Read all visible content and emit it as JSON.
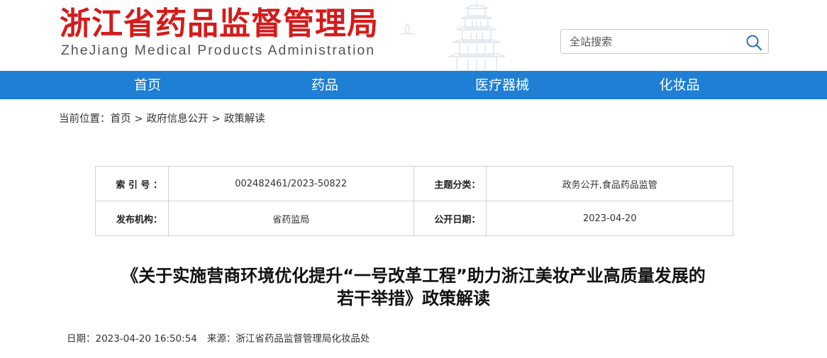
{
  "header": {
    "logo_cn": "浙江省药品监督管理局",
    "logo_en": "ZheJiang Medical Products Administration"
  },
  "search": {
    "placeholder": "全站搜索"
  },
  "nav": {
    "items": [
      "首页",
      "药品",
      "医疗器械",
      "化妆品"
    ]
  },
  "breadcrumb": {
    "prefix": "当前位置：",
    "items": [
      "首页",
      "政府信息公开",
      "政策解读"
    ],
    "separator": ">"
  },
  "meta": {
    "index_label": "索 引 号 ：",
    "index_value": "002482461/2023-50822",
    "category_label": "主题分类：",
    "category_value": "政务公开,食品药品监管",
    "publisher_label": "发布机构：",
    "publisher_value": "省药监局",
    "date_label": "公开日期：",
    "date_value": "2023-04-20"
  },
  "article": {
    "title_line1": "《关于实施营商环境优化提升“一号改革工程”助力浙江美妆产业高质量发展的",
    "title_line2": "若干举措》政策解读",
    "date": "日期：2023-04-20 16:50:54",
    "source": "来源：浙江省药品监督管理局化妆品处"
  },
  "colors": {
    "brand_red": "#d41b1b",
    "nav_blue": "#1e7fd4"
  }
}
